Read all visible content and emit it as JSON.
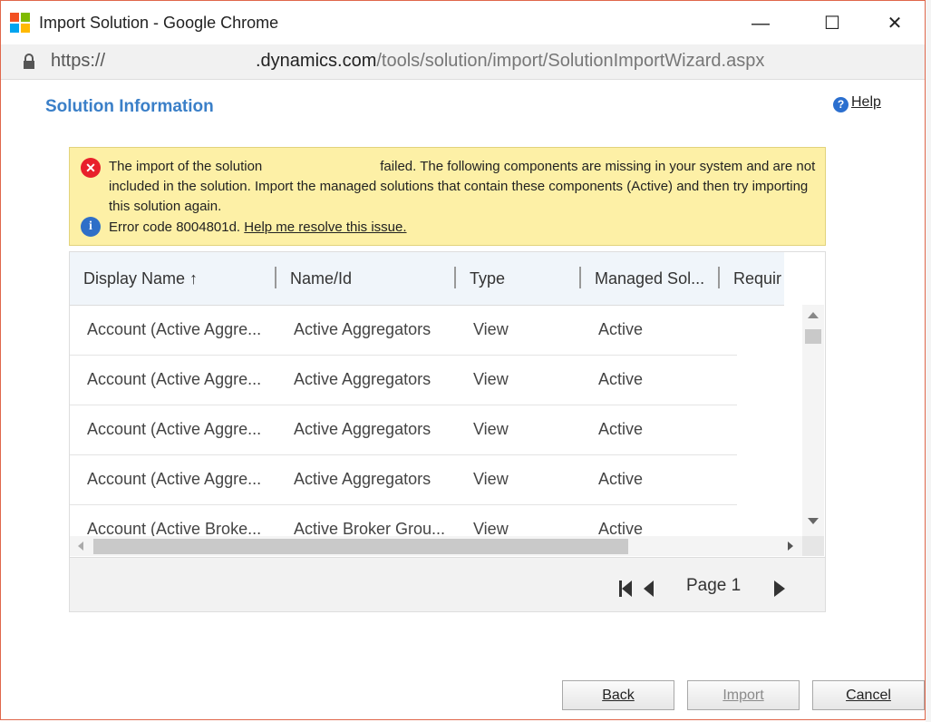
{
  "window": {
    "title": "Import Solution - Google Chrome",
    "minimize": "—",
    "maximize": "☐",
    "close": "✕"
  },
  "address": {
    "scheme": "https://",
    "domain": ".dynamics.com",
    "path": "/tools/solution/import/SolutionImportWizard.aspx"
  },
  "page": {
    "title": "Solution Information",
    "help_label": "Help"
  },
  "alert": {
    "message_pre": "The import of the solution",
    "message_post": "failed. The following components are missing in your system and are not included in the solution. Import the managed solutions that contain these components (Active) and then try importing this solution again.",
    "error_code": "Error code 8004801d.",
    "resolve_link": "Help me resolve this issue."
  },
  "grid": {
    "columns": [
      "Display Name ↑",
      "Name/Id",
      "Type",
      "Managed Sol...",
      "Requir"
    ],
    "rows": [
      [
        "Account (Active Aggre...",
        "Active Aggregators",
        "View",
        "Active"
      ],
      [
        "Account (Active Aggre...",
        "Active Aggregators",
        "View",
        "Active"
      ],
      [
        "Account (Active Aggre...",
        "Active Aggregators",
        "View",
        "Active"
      ],
      [
        "Account (Active Aggre...",
        "Active Aggregators",
        "View",
        "Active"
      ],
      [
        "Account (Active Broke...",
        "Active Broker Grou...",
        "View",
        "Active"
      ]
    ],
    "page_label": "Page 1"
  },
  "buttons": {
    "back": "Back",
    "import": "Import",
    "cancel": "Cancel"
  },
  "colors": {
    "accent": "#3a7fc8",
    "alert_bg": "#fdf0a6",
    "error": "#e8202b",
    "info": "#2f6fc8"
  }
}
